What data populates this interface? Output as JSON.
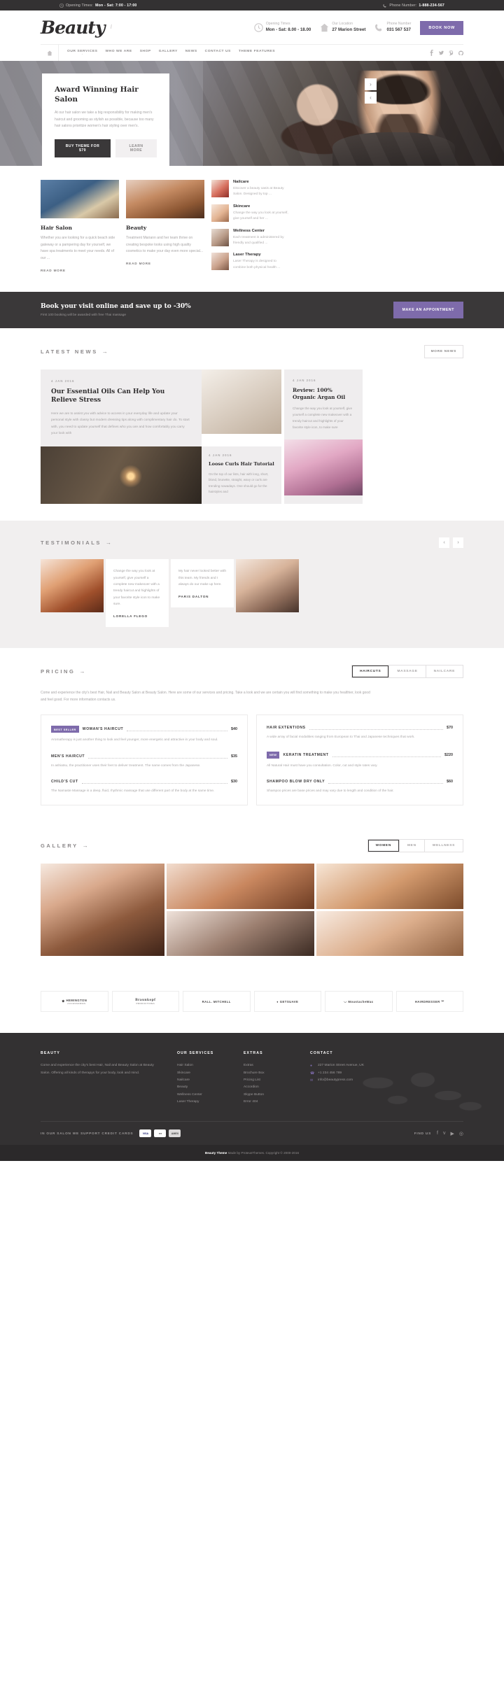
{
  "topbar": {
    "opening_label": "Opening Times:",
    "opening_value": "Mon - Sat: 7:00 - 17:00",
    "phone_label": "Phone Number:",
    "phone_value": "1-888-234-567",
    "clock_icon": "clock-icon",
    "phone_icon": "phone-icon"
  },
  "header": {
    "logo": "Beauty",
    "info": [
      {
        "icon": "clock-icon",
        "label": "Opening Times",
        "value": "Mon - Sat: 8.00 - 18.00"
      },
      {
        "icon": "home-icon",
        "label": "Our Location",
        "value": "27 Marion Street"
      },
      {
        "icon": "phone-icon",
        "label": "Phone Number",
        "value": "031 567 537"
      }
    ],
    "book_now": "BOOK NOW"
  },
  "nav": {
    "home_icon": "home-icon",
    "items": [
      {
        "label": "OUR SERVICES",
        "has_sub": true
      },
      {
        "label": "WHO WE ARE",
        "has_sub": false
      },
      {
        "label": "SHOP",
        "has_sub": false
      },
      {
        "label": "GALLERY",
        "has_sub": false
      },
      {
        "label": "NEWS",
        "has_sub": false
      },
      {
        "label": "CONTACT US",
        "has_sub": false
      },
      {
        "label": "THEME FEATURES",
        "has_sub": false
      }
    ],
    "socials": [
      {
        "name": "facebook-icon",
        "glyph": "f"
      },
      {
        "name": "twitter-icon",
        "glyph": "ᴠ"
      },
      {
        "name": "pinterest-icon",
        "glyph": "ⓟ"
      },
      {
        "name": "github-icon",
        "glyph": "○"
      }
    ]
  },
  "hero": {
    "title": "Award Winning Hair Salon",
    "desc": "At our hair salon we take a big responsibility for making men's haircut and grooming as stylish as possible, because too many hair salons prioritize women's hair styling over men's.",
    "btn_primary": "BUY THEME FOR $79",
    "btn_secondary": "LEARN MORE",
    "arrow_next": "›",
    "arrow_prev": "‹"
  },
  "services": {
    "cards": [
      {
        "title": "Hair Salon",
        "desc": "Whether you are looking for a quick beach side gateway or a pampering day for yourself, we have spa treatments to meet your needs. All of our ...",
        "readmore": "READ MORE"
      },
      {
        "title": "Beauty",
        "desc": "Treatment Mariann and her team thrive on creating bespoke looks using high quality cosmetics to make your day even more special...",
        "readmore": "READ MORE"
      }
    ],
    "list": [
      {
        "title": "Nailcare",
        "desc": "Discover a beauty oasis at Beauty Salon. Designed by top ..."
      },
      {
        "title": "Skincare",
        "desc": "Change the way you look at yourself, give yourself and her ..."
      },
      {
        "title": "Wellness Center",
        "desc": "Each treatment is administered by friendly and qualified ..."
      },
      {
        "title": "Laser Therapy",
        "desc": "Laser Therapy is designed to combine both physical health ..."
      }
    ]
  },
  "cta": {
    "title": "Book your visit online and save up to -30%",
    "subtitle": "First 100 booking will be awarded with free Thai massage",
    "button": "MAKE AN APPOINTMENT"
  },
  "news": {
    "section_title": "LATEST NEWS",
    "more_button": "MORE NEWS",
    "main": {
      "date": "4 JAN 2016",
      "title": "Our Essential Oils Can Help You Relieve Stress",
      "desc": "Here we are to assist you with advice to access in your everyday life and update your personal style with classy but modern dressing tips along with complimentary hair do. To start with, you need to update yourself that defines who you are and how comfortably you carry your look with"
    },
    "bottom": {
      "date": "4 JAN 2016",
      "title": "Loose Curls Hair Tutorial",
      "desc": "On the top of our lists, hair with long, short, blond, brunette, straight, wavy or curls are trending nowadays. One should go for the hairstyles and"
    },
    "side": {
      "date": "4 JAN 2016",
      "title": "Review: 100% Organic Argan Oil",
      "desc": "Change the way you look at yourself, give yourself a complete new makeover with a trendy haircut and highlights of your favorite style icon, to make sure"
    }
  },
  "testimonials": {
    "section_title": "TESTIMONIALS",
    "prev": "‹",
    "next": "›",
    "items": [
      {
        "quote": "Change the way you look at yourself, give yourself a complete new makeover with a trendy haircut and highlights of your favorite style icon to make sure.",
        "author": "LORELLA FLEGO"
      },
      {
        "quote": "My hair never looked better with this team. My friends and I always do our make up here.",
        "author": "PARIS DALTON"
      }
    ]
  },
  "pricing": {
    "section_title": "PRICING",
    "tabs": [
      {
        "label": "HAIRCUTS",
        "active": true
      },
      {
        "label": "MASSAGE",
        "active": false
      },
      {
        "label": "NAILCARE",
        "active": false
      }
    ],
    "intro": "Come and experience the city's best Hair, Nail and Beauty Salon at Beauty Salon. Here are some of our services and pricing. Take a look and we are certain you will find something to make you healthier, look good and feel good. For more information contacts us.",
    "left_items": [
      {
        "badge": "BEST SELLER",
        "name": "WOMAN'S HAIRCUT",
        "price": "$40",
        "desc": "Aromatherapy is just another thing to look and feel younger, more energetic and attractive in your body and soul."
      },
      {
        "badge": "",
        "name": "MEN'S HAIRCUT",
        "price": "$35",
        "desc": "In ashiatsu, the practitioner uses their feet to deliver treatment. The name comes from the Japanese."
      },
      {
        "badge": "",
        "name": "CHILD'S CUT",
        "price": "$30",
        "desc": "The Namaste Massage is a deep, fluid, rhythmic massage that use different part of the body at the same time."
      }
    ],
    "right_items": [
      {
        "badge": "",
        "name": "HAIR EXTENTIONS",
        "price": "$70",
        "desc": "A wide array of facial modalities ranging from European to Thai and Japanese techniques that work."
      },
      {
        "badge": "NEW",
        "name": "KERATIN TREATMENT",
        "price": "$220",
        "desc": "All Natural Hair must have you consultation. Color, cut and style rates vary."
      },
      {
        "badge": "",
        "name": "SHAMPOO BLOW DRY ONLY",
        "price": "$60",
        "desc": "Shampoo prices are base prices and may vary due to length and condition of the hair."
      }
    ]
  },
  "gallery": {
    "section_title": "GALLERY",
    "tabs": [
      {
        "label": "WOMEN",
        "active": true
      },
      {
        "label": "MEN",
        "active": false
      },
      {
        "label": "WELLNESS",
        "active": false
      }
    ]
  },
  "brands": [
    {
      "name": "HEMINGTON",
      "sub": "ACCESSORIES",
      "icon": "crown-icon"
    },
    {
      "name": "Braunkopf",
      "sub": "PRODUCTIONS",
      "icon": ""
    },
    {
      "name": "RALL. MITCHELL",
      "sub": "",
      "icon": ""
    },
    {
      "name": "GETSUAVE",
      "sub": "",
      "icon": "droplet-icon"
    },
    {
      "name": "MoustacheWax",
      "sub": "",
      "icon": "moustache-icon"
    },
    {
      "name": "HAIRDRESSER",
      "sub": "",
      "icon": "scissors-icon"
    }
  ],
  "footer": {
    "about": {
      "title": "BEAUTY",
      "text": "Come and experience the city's best Hair, Nail and Beauty Salon at Beauty Salon. Offering all kinds of therapys for your body, look and mind."
    },
    "services": {
      "title": "OUR SERVICES",
      "items": [
        "Hair Salon",
        "Skincare",
        "Nailcare",
        "Beauty",
        "Wellness Center",
        "Laser Therapy"
      ]
    },
    "extras": {
      "title": "EXTRAS",
      "items": [
        "Extras",
        "Brochure Box",
        "Pricing List",
        "Accordion",
        "Skype Button",
        "Error 404"
      ]
    },
    "contact": {
      "title": "CONTACT",
      "items": [
        {
          "icon": "pin-icon",
          "text": "227 Marion Street Avenue, UK"
        },
        {
          "icon": "phone-icon",
          "text": "+1 234 456 789"
        },
        {
          "icon": "mail-icon",
          "text": "info@beautypress.com"
        }
      ]
    },
    "cards_label": "IN OUR SALON WE SUPPORT CREDIT CARDS",
    "cards": [
      {
        "name": "visa-card-icon",
        "label": "VISA"
      },
      {
        "name": "mastercard-icon",
        "label": "●●"
      },
      {
        "name": "amex-card-icon",
        "label": "AMEX"
      }
    ],
    "find_us": "FIND US",
    "socials": [
      {
        "name": "facebook-icon",
        "glyph": "f"
      },
      {
        "name": "twitter-icon",
        "glyph": "ᴠ"
      },
      {
        "name": "youtube-icon",
        "glyph": "▶"
      },
      {
        "name": "instagram-icon",
        "glyph": "◎"
      }
    ],
    "copyright_brand": "Beauty Theme",
    "copyright_rest": "Made by ProteusThemes. Copyright © 2000-2016"
  }
}
